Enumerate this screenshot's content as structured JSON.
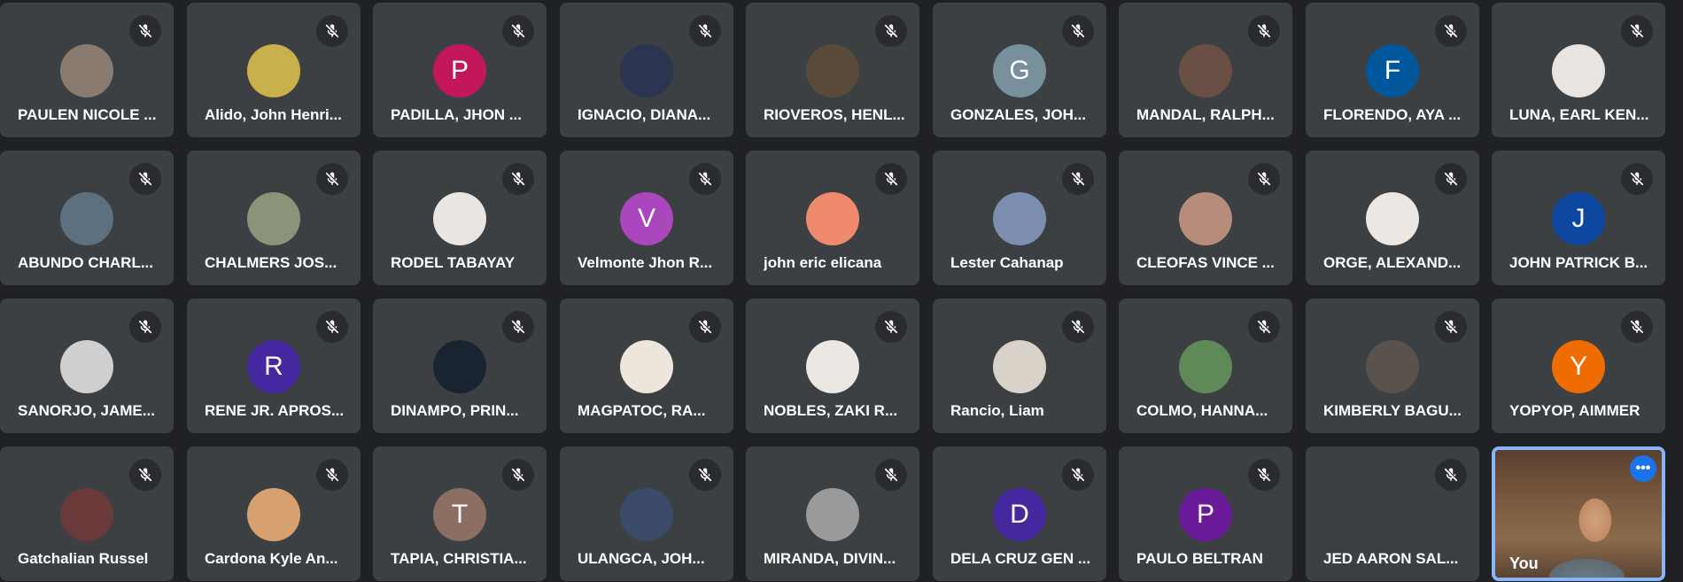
{
  "participants": [
    {
      "name": "PAULEN NICOLE ...",
      "initial": "",
      "color": "#8a7b70"
    },
    {
      "name": "Alido, John Henri...",
      "initial": "",
      "color": "#c9b04a"
    },
    {
      "name": "PADILLA, JHON ...",
      "initial": "P",
      "color": "#c2185b"
    },
    {
      "name": "IGNACIO, DIANA...",
      "initial": "",
      "color": "#2c3550"
    },
    {
      "name": "RIOVEROS, HENL...",
      "initial": "",
      "color": "#5a4a3a"
    },
    {
      "name": "GONZALES, JOH...",
      "initial": "G",
      "color": "#78909c"
    },
    {
      "name": "MANDAL, RALPH...",
      "initial": "",
      "color": "#6a4f45"
    },
    {
      "name": "FLORENDO, AYA ...",
      "initial": "F",
      "color": "#01579b"
    },
    {
      "name": "LUNA, EARL KEN...",
      "initial": "",
      "color": "#e8e4e0"
    },
    {
      "name": "ABUNDO CHARL...",
      "initial": "",
      "color": "#5d7080"
    },
    {
      "name": "CHALMERS JOS...",
      "initial": "",
      "color": "#8a9478"
    },
    {
      "name": "RODEL TABAYAY",
      "initial": "",
      "color": "#e9e6e1"
    },
    {
      "name": "Velmonte Jhon R...",
      "initial": "V",
      "color": "#ab47bc"
    },
    {
      "name": "john eric elicana",
      "initial": "",
      "color": "#f08a6c"
    },
    {
      "name": "Lester Cahanap",
      "initial": "",
      "color": "#7c8fb0"
    },
    {
      "name": "CLEOFAS VINCE ...",
      "initial": "",
      "color": "#b88c7a"
    },
    {
      "name": "ORGE, ALEXAND...",
      "initial": "",
      "color": "#ece7e2"
    },
    {
      "name": "JOHN PATRICK B...",
      "initial": "J",
      "color": "#0d47a1"
    },
    {
      "name": "SANORJO, JAME...",
      "initial": "",
      "color": "#cfcfcf"
    },
    {
      "name": "RENE JR. APROS...",
      "initial": "R",
      "color": "#4527a0"
    },
    {
      "name": "DINAMPO, PRIN...",
      "initial": "",
      "color": "#1a2430"
    },
    {
      "name": "MAGPATOC, RA...",
      "initial": "",
      "color": "#eee5dc"
    },
    {
      "name": "NOBLES, ZAKI R...",
      "initial": "",
      "color": "#ebe7e3"
    },
    {
      "name": "Rancio, Liam",
      "initial": "",
      "color": "#d8d2c8"
    },
    {
      "name": "COLMO, HANNA...",
      "initial": "",
      "color": "#5f8a58"
    },
    {
      "name": "KIMBERLY BAGU...",
      "initial": "",
      "color": "#5a524c"
    },
    {
      "name": "YOPYOP, AIMMER",
      "initial": "Y",
      "color": "#ef6c00"
    },
    {
      "name": "Gatchalian Russel",
      "initial": "",
      "color": "#6a3a3a"
    },
    {
      "name": "Cardona Kyle An...",
      "initial": "",
      "color": "#d6a070"
    },
    {
      "name": "TAPIA, CHRISTIA...",
      "initial": "T",
      "color": "#8d6e63"
    },
    {
      "name": "ULANGCA, JOH...",
      "initial": "",
      "color": "#3c4a6a"
    },
    {
      "name": "MIRANDA, DIVIN...",
      "initial": "",
      "color": "#9a9a9a"
    },
    {
      "name": "DELA CRUZ GEN ...",
      "initial": "D",
      "color": "#4527a0"
    },
    {
      "name": "PAULO BELTRAN",
      "initial": "P",
      "color": "#6a1b9a"
    },
    {
      "name": "JED AARON SAL...",
      "initial": "",
      "color": "#3a3f44"
    }
  ],
  "self": {
    "name": "You",
    "more_label": "•••"
  },
  "icons": {
    "mute": "mic-off-icon",
    "more": "more-options-icon"
  },
  "colors": {
    "background": "#202124",
    "tile": "#3c4043",
    "self_border": "#8ab4f8",
    "more_button": "#1a73e8"
  }
}
